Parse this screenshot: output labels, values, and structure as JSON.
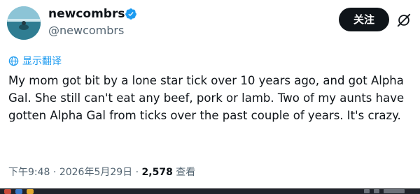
{
  "author": {
    "display_name": "newcombrs",
    "handle": "@newcombrs",
    "verified": true,
    "avatar_icon": "avatar-image"
  },
  "actions": {
    "follow_label": "关注",
    "grok_icon": "grok-icon"
  },
  "translate": {
    "label": "显示翻译",
    "icon": "globe-icon"
  },
  "post": {
    "text": "My mom got bit by a lone star tick over 10 years ago, and got Alpha Gal.  She still can't eat any beef, pork or lamb.  Two of my aunts have gotten Alpha Gal from ticks over the past couple of years.  It's crazy."
  },
  "meta": {
    "time": "下午9:48",
    "separator": " · ",
    "date": "2026年5月29日",
    "views_count": "2,578",
    "views_label": "查看"
  },
  "colors": {
    "link": "#1d9bf0",
    "verified": "#1d9bf0",
    "secondary_text": "#536471",
    "primary_text": "#0f1419",
    "button_bg": "#0f1419"
  }
}
